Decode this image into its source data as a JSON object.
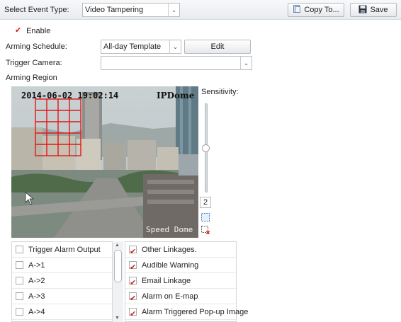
{
  "header": {
    "event_type_label": "Select Event Type:",
    "event_type_value": "Video Tampering",
    "copy_label": "Copy To...",
    "save_label": "Save"
  },
  "enable": {
    "label": "Enable",
    "checked": true
  },
  "schedule": {
    "label": "Arming Schedule:",
    "value": "All-day Template",
    "edit_label": "Edit"
  },
  "trigger_camera": {
    "label": "Trigger Camera:",
    "value": ""
  },
  "arming_region": {
    "label": "Arming Region"
  },
  "video": {
    "timestamp": "2014-06-02 19:02:14",
    "camera_name": "IPDome",
    "channel_name": "Speed Dome"
  },
  "sensitivity": {
    "label": "Sensitivity:",
    "value": "2",
    "level": 2,
    "max": 5
  },
  "alarm_output": {
    "items": [
      {
        "label": "Trigger Alarm Output",
        "checked": false
      },
      {
        "label": "A->1",
        "checked": false
      },
      {
        "label": "A->2",
        "checked": false
      },
      {
        "label": "A->3",
        "checked": false
      },
      {
        "label": "A->4",
        "checked": false
      }
    ]
  },
  "linkages": {
    "items": [
      {
        "label": "Other Linkages.",
        "checked": true
      },
      {
        "label": "Audible Warning",
        "checked": true
      },
      {
        "label": "Email Linkage",
        "checked": true
      },
      {
        "label": "Alarm on E-map",
        "checked": true
      },
      {
        "label": "Alarm Triggered Pop-up Image",
        "checked": true
      }
    ]
  },
  "icons": {
    "copy": "copy-icon",
    "save": "floppy-disk-icon",
    "draw_area": "draw-area-icon",
    "clear_area": "clear-area-icon",
    "dropdown": "chevron-down-icon"
  },
  "colors": {
    "check": "#d0221b",
    "region_grid": "#e01818"
  }
}
